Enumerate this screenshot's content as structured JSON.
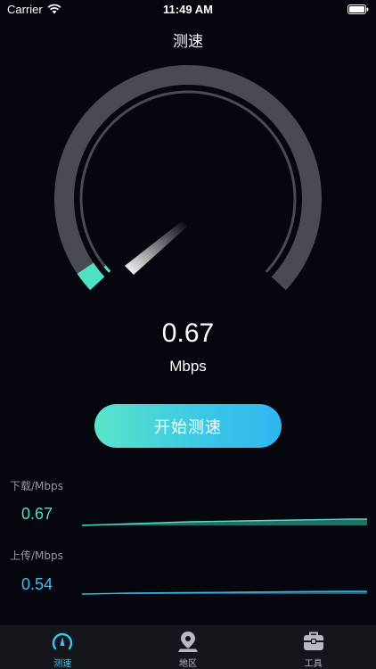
{
  "status_bar": {
    "carrier": "Carrier",
    "time": "11:49 AM"
  },
  "nav": {
    "title": "测速"
  },
  "gauge": {
    "speed_value": "0.67",
    "speed_unit": "Mbps",
    "accent_color": "#4de0c2",
    "track_color": "#4a4a52"
  },
  "start_button": {
    "label": "开始测速"
  },
  "stats": {
    "download": {
      "label": "下载/Mbps",
      "value": "0.67",
      "color": "#4de0c2"
    },
    "upload": {
      "label": "上传/Mbps",
      "value": "0.54",
      "color": "#33c4ef"
    }
  },
  "tab_bar": {
    "tabs": [
      {
        "label": "测速",
        "icon": "speedometer-icon",
        "active": true
      },
      {
        "label": "地区",
        "icon": "map-pin-icon",
        "active": false
      },
      {
        "label": "工具",
        "icon": "toolbox-icon",
        "active": false
      }
    ]
  }
}
